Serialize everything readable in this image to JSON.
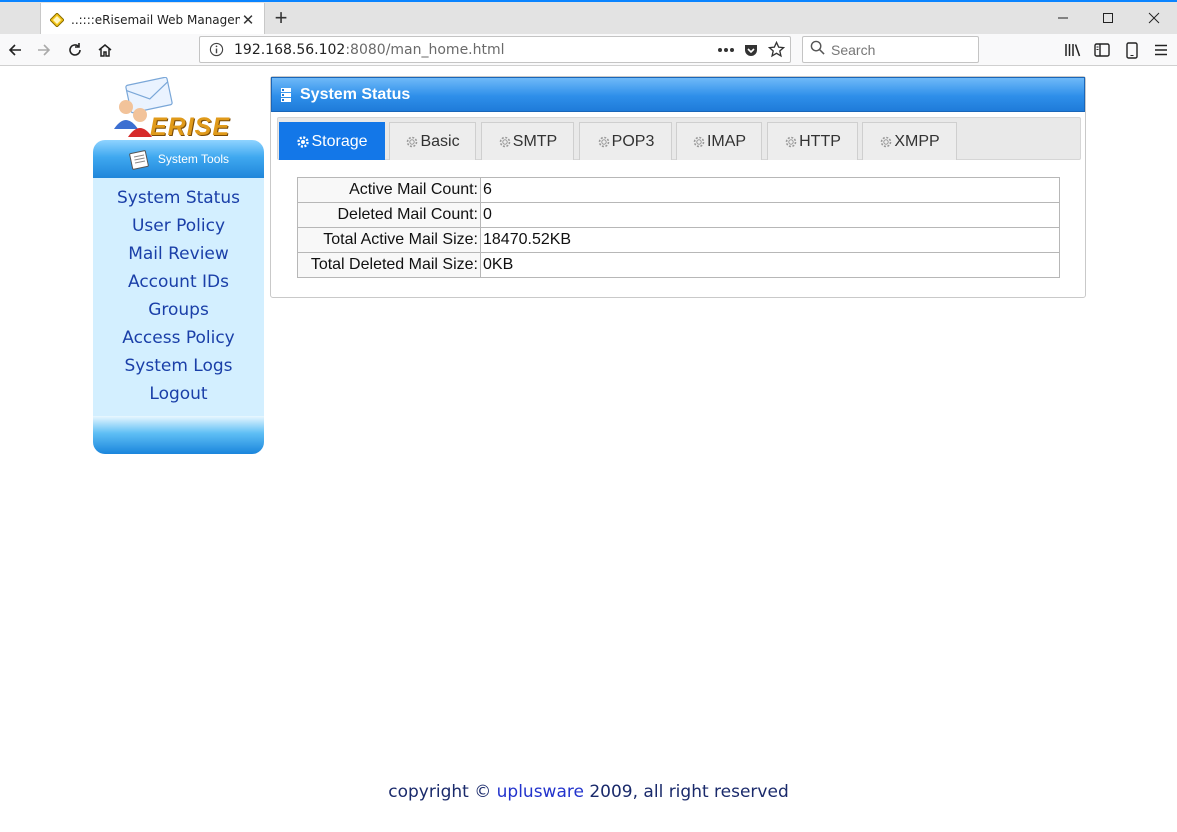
{
  "browser": {
    "tab_title": "..::::eRisemail Web Manageme",
    "url_host": "192.168.56.102",
    "url_rest": ":8080/man_home.html",
    "search_placeholder": "Search"
  },
  "logo": {
    "text": "ERISE"
  },
  "sidebar": {
    "header": "System Tools",
    "items": [
      {
        "label": "System Status"
      },
      {
        "label": "User Policy"
      },
      {
        "label": "Mail Review"
      },
      {
        "label": "Account IDs"
      },
      {
        "label": "Groups"
      },
      {
        "label": "Access Policy"
      },
      {
        "label": "System Logs"
      },
      {
        "label": "Logout"
      }
    ]
  },
  "panel": {
    "title": "System Status",
    "tabs": [
      {
        "label": "Storage",
        "active": true
      },
      {
        "label": "Basic"
      },
      {
        "label": "SMTP"
      },
      {
        "label": "POP3"
      },
      {
        "label": "IMAP"
      },
      {
        "label": "HTTP"
      },
      {
        "label": "XMPP"
      }
    ],
    "rows": [
      {
        "key": "Active Mail Count:",
        "value": "6"
      },
      {
        "key": "Deleted Mail Count:",
        "value": "0"
      },
      {
        "key": "Total Active Mail Size:",
        "value": "18470.52KB"
      },
      {
        "key": "Total Deleted Mail Size:",
        "value": "0KB"
      }
    ]
  },
  "footer": {
    "prefix": "copyright © ",
    "brand": "uplusware",
    "suffix": " 2009, all right reserved"
  },
  "colors": {
    "accent": "#0a84ff",
    "tab_active": "#1377e8",
    "sidebar_bg": "#d3efff",
    "link": "#1a3fa8"
  }
}
